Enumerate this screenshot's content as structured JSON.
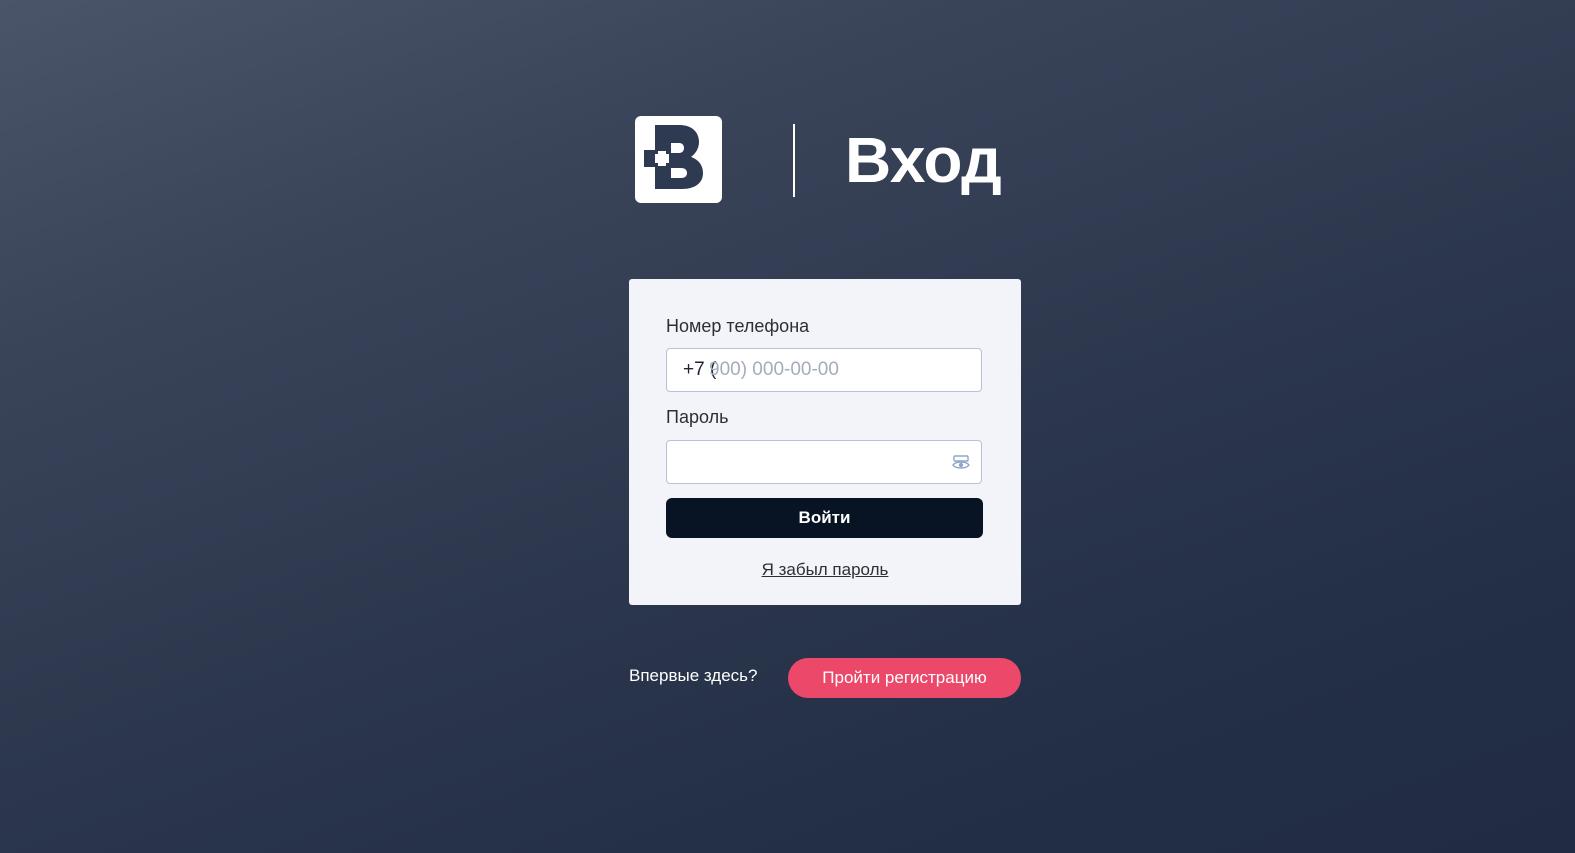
{
  "header": {
    "title": "Вход",
    "logo_icon": "plus-b-logo-icon"
  },
  "login_form": {
    "phone_label": "Номер телефона",
    "phone_prefix": "+7 (",
    "phone_placeholder": "900) 000-00-00",
    "password_label": "Пароль",
    "password_value": "",
    "password_toggle_icon": "eye-icon",
    "submit_label": "Войти",
    "forgot_label": "Я забыл пароль"
  },
  "register": {
    "prompt": "Впервые здесь?",
    "button_label": "Пройти регистрацию"
  },
  "colors": {
    "background": "#2c374d",
    "card": "#f3f4f9",
    "primary_button": "#081423",
    "accent": "#ec4869"
  }
}
